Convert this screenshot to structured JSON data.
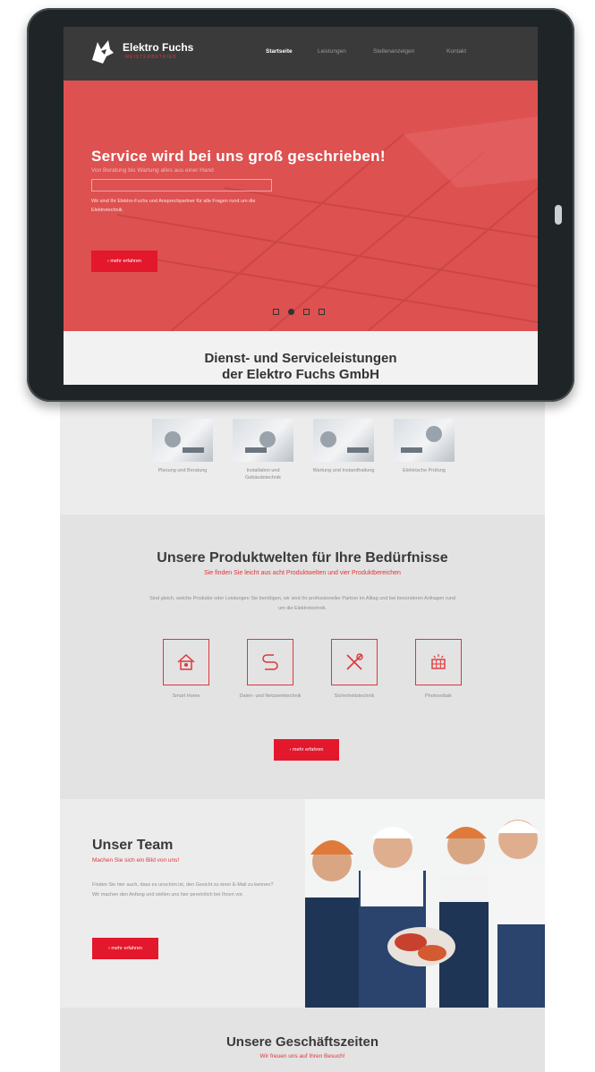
{
  "brand": {
    "name": "Elektro Fuchs",
    "tagline": "MEISTERBETRIEB",
    "accent": "#e3182c"
  },
  "nav": {
    "items": [
      {
        "label": "Startseite",
        "active": true
      },
      {
        "label": "Leistungen",
        "active": false
      },
      {
        "label": "Stellenanzeigen",
        "active": false
      },
      {
        "label": "Kontakt",
        "active": false
      }
    ]
  },
  "hero": {
    "title": "Service wird bei uns groß geschrieben!",
    "lead": "Von Beratung bis Wartung alles aus einer Hand",
    "text": "Wir sind Ihr Elektro-Fuchs und Ansprechpartner für alle Fragen rund um die Elektrotechnik.",
    "button": "› mehr erfahren",
    "slides": 4,
    "active_slide": 2
  },
  "services": {
    "heading_line1": "Dienst- und Serviceleistungen",
    "heading_line2": "der Elektro Fuchs GmbH",
    "items": [
      {
        "label": "Planung und Beratung"
      },
      {
        "label": "Installation und Gebäudetechnik"
      },
      {
        "label": "Wartung und Instandhaltung"
      },
      {
        "label": "Elektrische Prüfung"
      }
    ]
  },
  "products": {
    "heading": "Unsere Produktwelten für Ihre Bedürfnisse",
    "subheading": "Sie finden Sie leicht aus acht Produktwelten und vier Produktbereichen",
    "description": "Sind gleich, welche Produkte oder Leistungen Sie benötigen, wir sind Ihr professioneller Partner im Alltag und bei besonderen Anfragen rund um die Elektrotechnik.",
    "items": [
      {
        "label": "Smart Home",
        "icon": "smart-home-icon"
      },
      {
        "label": "Daten- und Netzwerktechnik",
        "icon": "cable-icon"
      },
      {
        "label": "Sicherheitstechnik",
        "icon": "tools-icon"
      },
      {
        "label": "Photovoltaik",
        "icon": "solar-icon"
      }
    ],
    "button": "› mehr erfahren"
  },
  "team": {
    "heading": "Unser Team",
    "subheading": "Machen Sie sich ein Bild von uns!",
    "text": "Finden Sie hier auch, dass es unschön ist, den Gesicht zu einer E-Mail zu kennen? Wir machen den Anfang und stellen uns hier persönlich bei Ihnen vor.",
    "button": "› mehr erfahren"
  },
  "hours": {
    "heading": "Unsere Geschäftszeiten",
    "subheading": "Wir freuen uns auf Ihren Besuch!"
  }
}
